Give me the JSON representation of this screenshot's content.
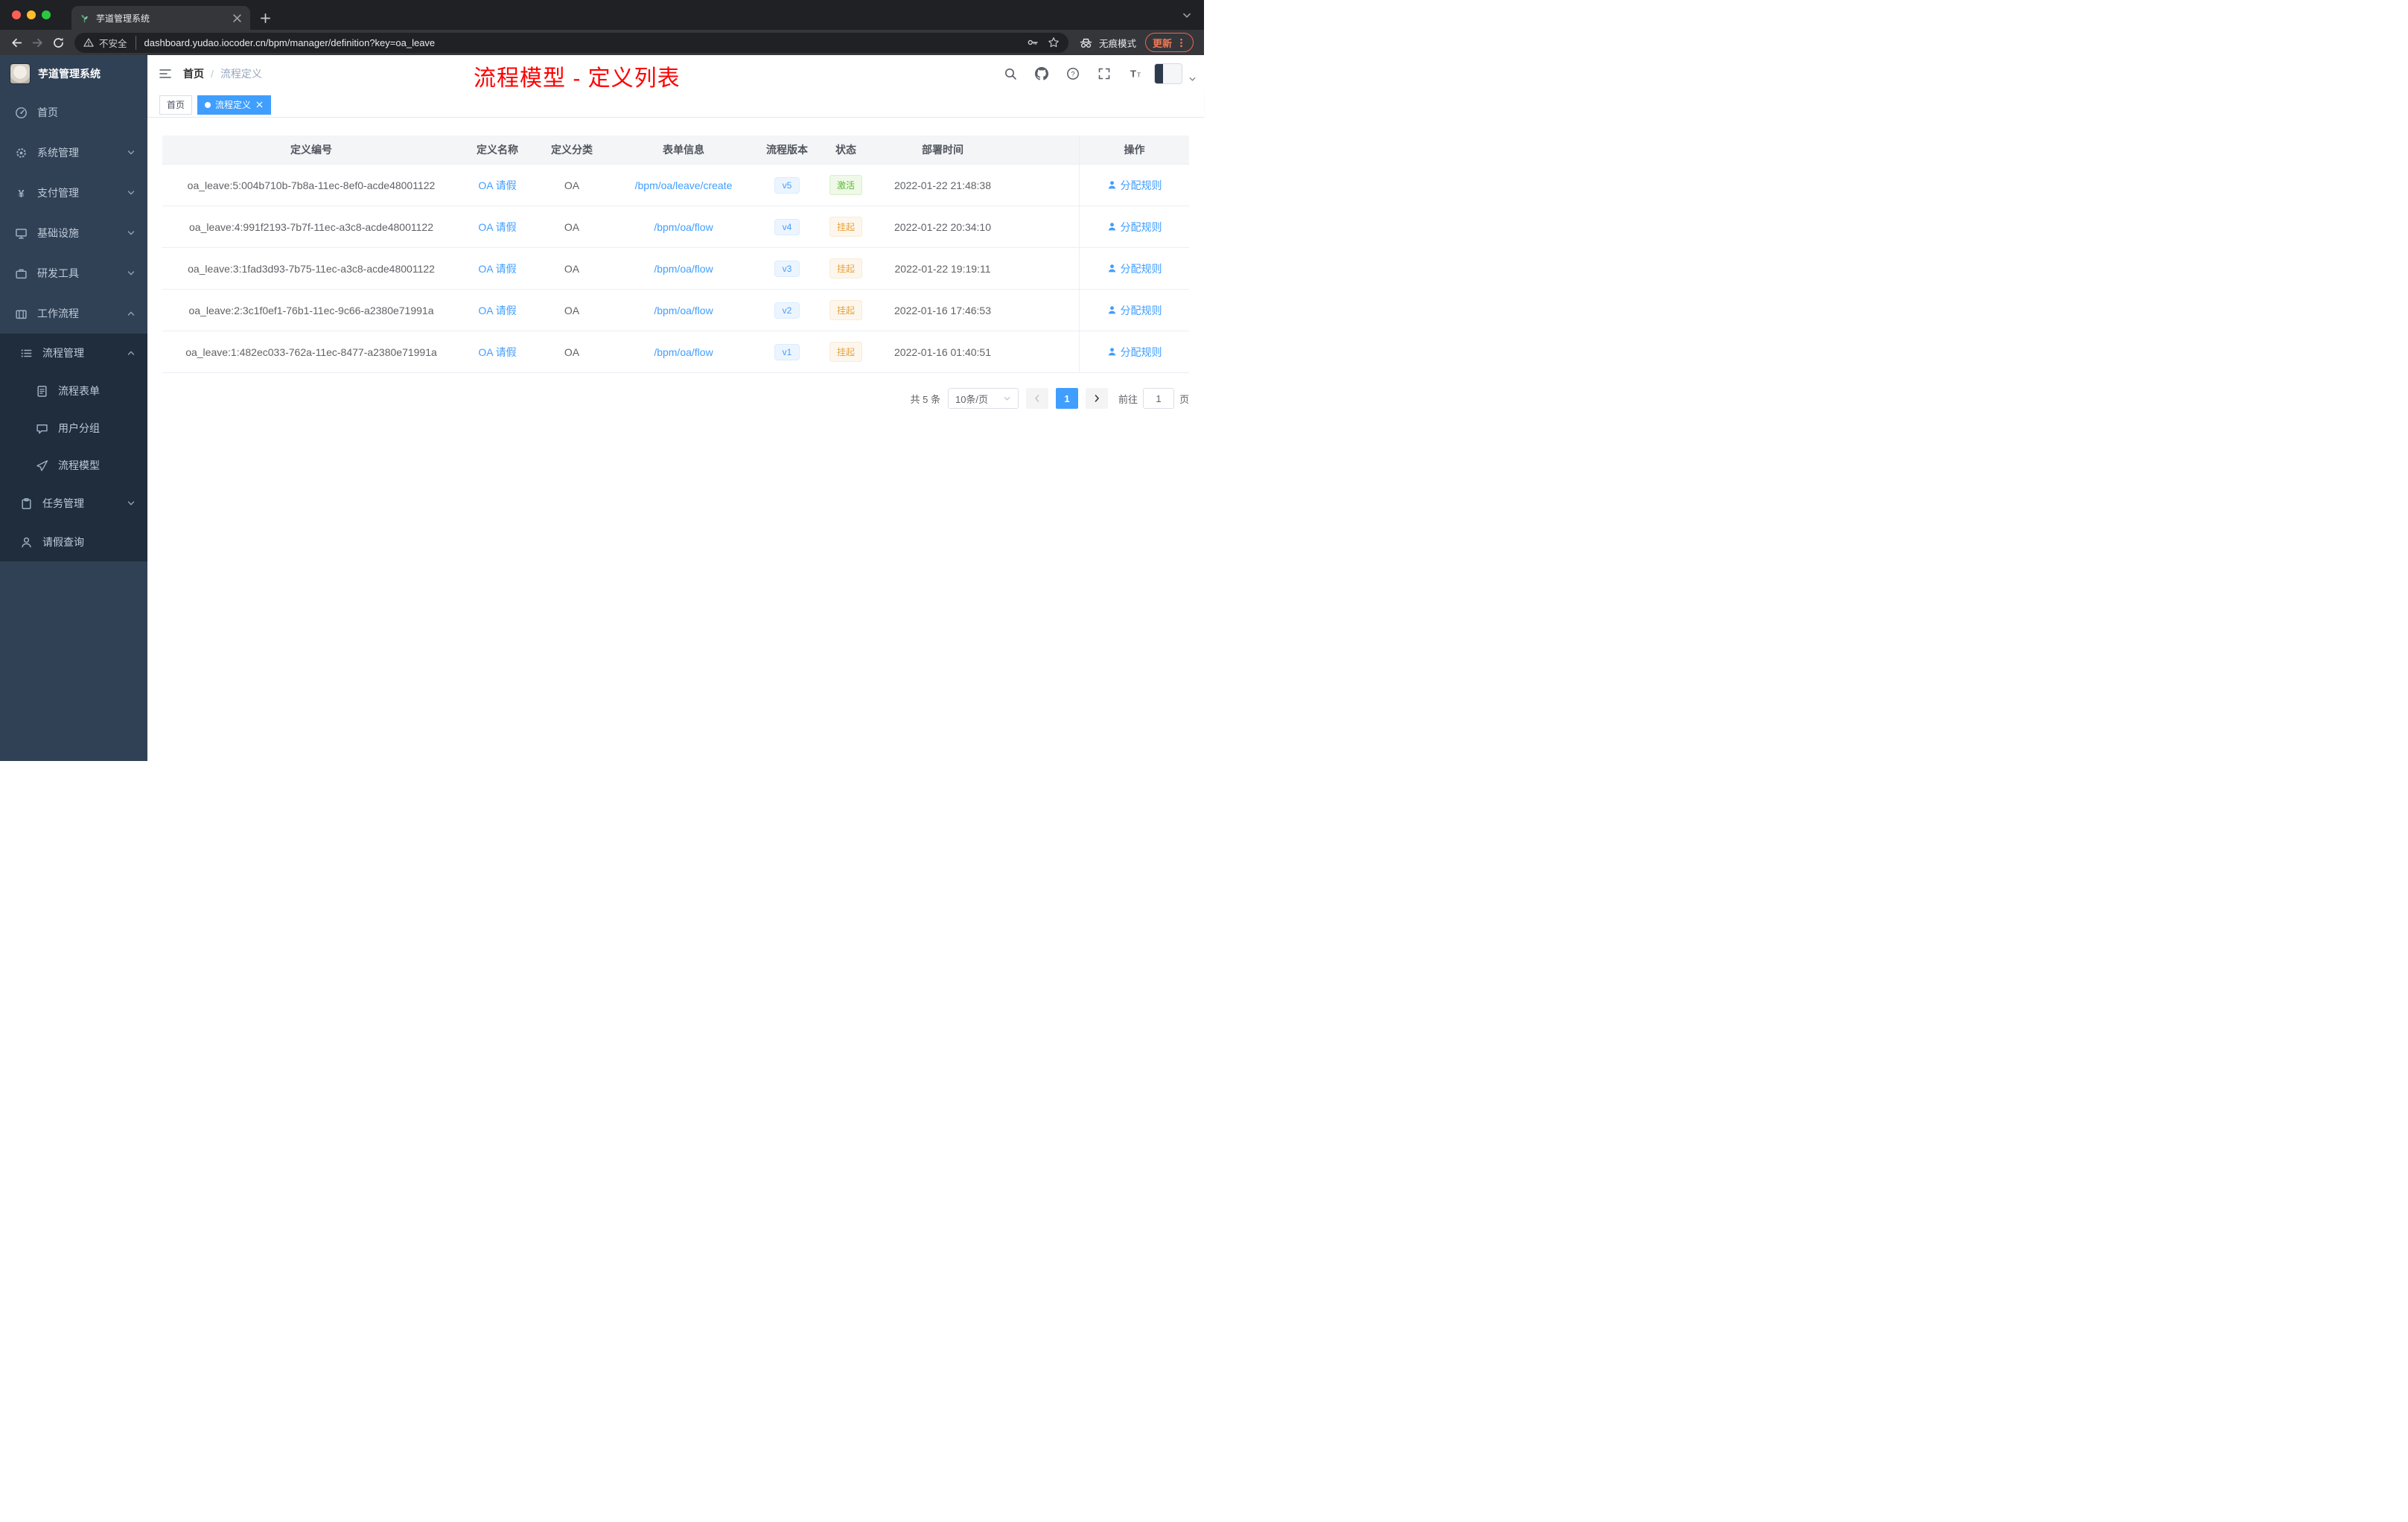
{
  "colors": {
    "accent": "#409eff",
    "success": "#67c23a",
    "warning": "#e6a23c",
    "annotation_red": "#fe0000",
    "sidebar_bg": "#304156",
    "submenu_bg": "#1f2d3d"
  },
  "browser": {
    "tab": {
      "title": "芋道管理系统"
    },
    "address": {
      "security": "不安全",
      "url": "dashboard.yudao.iocoder.cn/bpm/manager/definition?key=oa_leave",
      "incognito": "无痕模式",
      "update": "更新"
    }
  },
  "sidebar": {
    "title": "芋道管理系统",
    "menu": [
      {
        "key": "home",
        "label": "首页",
        "icon": "gauge-icon",
        "level": 1
      },
      {
        "key": "system",
        "label": "系统管理",
        "icon": "gear-icon",
        "level": 1,
        "arrow": "down"
      },
      {
        "key": "payment",
        "label": "支付管理",
        "icon": "yen-icon",
        "level": 1,
        "arrow": "down"
      },
      {
        "key": "infra",
        "label": "基础设施",
        "icon": "monitor-icon",
        "level": 1,
        "arrow": "down"
      },
      {
        "key": "devtools",
        "label": "研发工具",
        "icon": "briefcase-icon",
        "level": 1,
        "arrow": "down"
      },
      {
        "key": "workflow",
        "label": "工作流程",
        "icon": "suitcase-icon",
        "level": 1,
        "arrow": "up"
      },
      {
        "key": "process-manage",
        "label": "流程管理",
        "icon": "list-icon",
        "level": 2,
        "arrow": "up",
        "dark": true
      },
      {
        "key": "process-form",
        "label": "流程表单",
        "icon": "document-icon",
        "level": 3,
        "dark": true
      },
      {
        "key": "user-group",
        "label": "用户分组",
        "icon": "chat-icon",
        "level": 3,
        "dark": true
      },
      {
        "key": "process-model",
        "label": "流程模型",
        "icon": "paper-plane-icon",
        "level": 3,
        "dark": true
      },
      {
        "key": "task-manage",
        "label": "任务管理",
        "icon": "clipboard-icon",
        "level": 2,
        "arrow": "down",
        "dark": true
      },
      {
        "key": "leave-query",
        "label": "请假查询",
        "icon": "user-icon",
        "level": 2,
        "dark": true
      }
    ]
  },
  "header": {
    "breadcrumb": {
      "root": "首页",
      "separator": "/",
      "current": "流程定义"
    },
    "annotation": "流程模型 - 定义列表"
  },
  "tags": [
    {
      "label": "首页",
      "active": false
    },
    {
      "label": "流程定义",
      "active": true,
      "closable": true
    }
  ],
  "table": {
    "columns": [
      "定义编号",
      "定义名称",
      "定义分类",
      "表单信息",
      "流程版本",
      "状态",
      "部署时间",
      "操作"
    ],
    "rows": [
      {
        "id": "oa_leave:5:004b710b-7b8a-11ec-8ef0-acde48001122",
        "name": "OA 请假",
        "category": "OA",
        "form": "/bpm/oa/leave/create",
        "version": "v5",
        "status": "激活",
        "status_type": "success",
        "deployed_at": "2022-01-22 21:48:38",
        "action": "分配规则"
      },
      {
        "id": "oa_leave:4:991f2193-7b7f-11ec-a3c8-acde48001122",
        "name": "OA 请假",
        "category": "OA",
        "form": "/bpm/oa/flow",
        "version": "v4",
        "status": "挂起",
        "status_type": "warning",
        "deployed_at": "2022-01-22 20:34:10",
        "action": "分配规则"
      },
      {
        "id": "oa_leave:3:1fad3d93-7b75-11ec-a3c8-acde48001122",
        "name": "OA 请假",
        "category": "OA",
        "form": "/bpm/oa/flow",
        "version": "v3",
        "status": "挂起",
        "status_type": "warning",
        "deployed_at": "2022-01-22 19:19:11",
        "action": "分配规则"
      },
      {
        "id": "oa_leave:2:3c1f0ef1-76b1-11ec-9c66-a2380e71991a",
        "name": "OA 请假",
        "category": "OA",
        "form": "/bpm/oa/flow",
        "version": "v2",
        "status": "挂起",
        "status_type": "warning",
        "deployed_at": "2022-01-16 17:46:53",
        "action": "分配规则"
      },
      {
        "id": "oa_leave:1:482ec033-762a-11ec-8477-a2380e71991a",
        "name": "OA 请假",
        "category": "OA",
        "form": "/bpm/oa/flow",
        "version": "v1",
        "status": "挂起",
        "status_type": "warning",
        "deployed_at": "2022-01-16 01:40:51",
        "action": "分配规则"
      }
    ]
  },
  "pagination": {
    "total_label": "共 5 条",
    "page_size": "10条/页",
    "current_page": "1",
    "goto_prefix": "前往",
    "goto_value": "1",
    "goto_suffix": "页"
  }
}
